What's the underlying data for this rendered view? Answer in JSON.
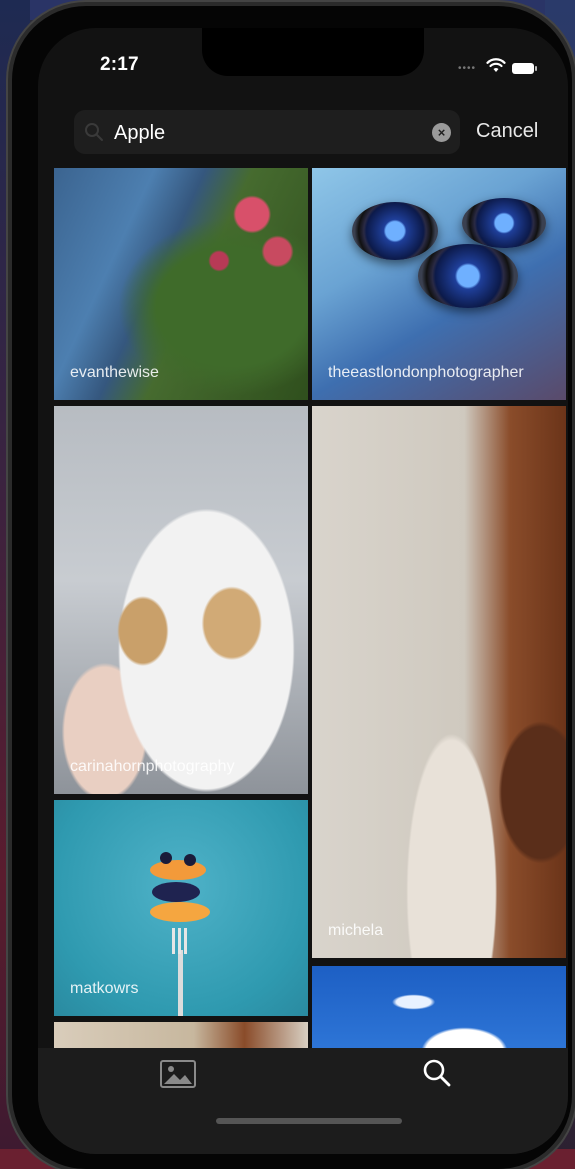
{
  "status_bar": {
    "time": "2:17",
    "icons": [
      "cellular-dots-icon",
      "wifi-icon",
      "battery-icon"
    ]
  },
  "search": {
    "value": "Apple",
    "cancel_label": "Cancel",
    "icons": [
      "search-icon",
      "clear-icon"
    ]
  },
  "results": [
    {
      "author": "evanthewise"
    },
    {
      "author": "theeastlondonphotographer"
    },
    {
      "author": "carinahornphotography"
    },
    {
      "author": "michela"
    },
    {
      "author": "matkowrs"
    },
    {
      "author": ""
    },
    {
      "author": ""
    }
  ],
  "tab_bar": {
    "items": [
      {
        "icon": "photo-icon",
        "selected": false
      },
      {
        "icon": "search-icon",
        "selected": true
      }
    ]
  }
}
